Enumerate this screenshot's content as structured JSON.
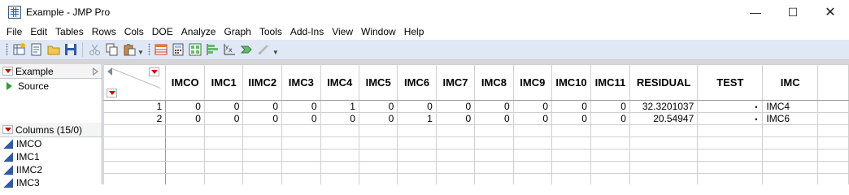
{
  "window": {
    "title": "Example - JMP Pro",
    "controls": [
      "—",
      "☐",
      "✕"
    ]
  },
  "menu": [
    "File",
    "Edit",
    "Tables",
    "Rows",
    "Cols",
    "DOE",
    "Analyze",
    "Graph",
    "Tools",
    "Add-Ins",
    "View",
    "Window",
    "Help"
  ],
  "table_panel": {
    "name": "Example",
    "script": "Source"
  },
  "columns_panel": {
    "header": "Columns (15/0)",
    "items": [
      "IMCO",
      "IMC1",
      "IIMC2",
      "IMC3"
    ]
  },
  "grid": {
    "headers": [
      "IMCO",
      "IMC1",
      "IIMC2",
      "IMC3",
      "IMC4",
      "IMC5",
      "IMC6",
      "IMC7",
      "IMC8",
      "IMC9",
      "IMC10",
      "IMC11",
      "RESIDUAL",
      "TEST",
      "IMC"
    ],
    "rows": [
      {
        "n": "1",
        "cells": [
          "0",
          "0",
          "0",
          "0",
          "1",
          "0",
          "0",
          "0",
          "0",
          "0",
          "0",
          "0",
          "32.3201037",
          "•",
          "IMC4"
        ]
      },
      {
        "n": "2",
        "cells": [
          "0",
          "0",
          "0",
          "0",
          "0",
          "0",
          "1",
          "0",
          "0",
          "0",
          "0",
          "0",
          "20.54947",
          "•",
          "IMC6"
        ]
      }
    ]
  },
  "colors": {
    "toolbar_bg": "#e0e8f6",
    "red_triangle": "#d10000",
    "green_script": "#2e9d3a",
    "continuous_icon": "#2f5aa8"
  }
}
